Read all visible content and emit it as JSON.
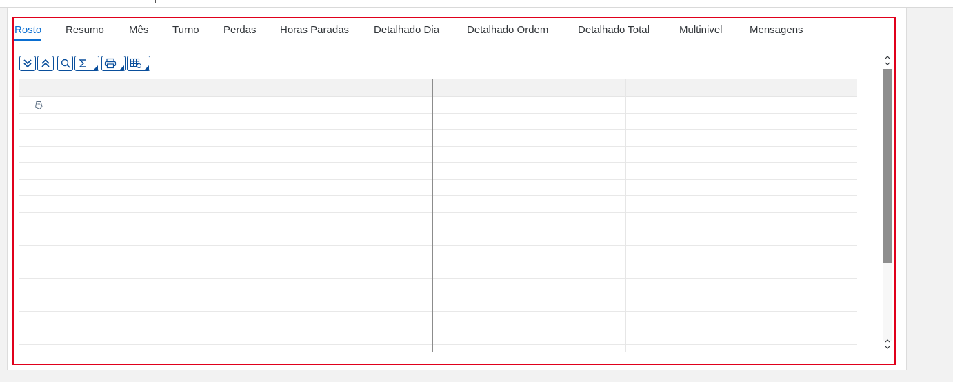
{
  "tabs": [
    {
      "label": "Rosto",
      "active": true
    },
    {
      "label": "Resumo",
      "active": false
    },
    {
      "label": "Mês",
      "active": false
    },
    {
      "label": "Turno",
      "active": false
    },
    {
      "label": "Perdas",
      "active": false
    },
    {
      "label": "Horas Paradas",
      "active": false
    },
    {
      "label": "Detalhado Dia",
      "active": false
    },
    {
      "label": "Detalhado Ordem",
      "active": false
    },
    {
      "label": "Detalhado Total",
      "active": false
    },
    {
      "label": "Multinivel",
      "active": false
    },
    {
      "label": "Mensagens",
      "active": false
    }
  ],
  "toolbar": {
    "buttons": [
      {
        "icon": "expand-all-icon"
      },
      {
        "icon": "collapse-all-icon"
      },
      {
        "icon": "search-icon"
      },
      {
        "icon": "sum-icon",
        "menu": true
      },
      {
        "icon": "print-icon",
        "menu": true
      },
      {
        "icon": "layout-settings-icon",
        "menu": true
      }
    ]
  },
  "grid": {
    "columns": [
      "",
      "",
      "",
      "",
      ""
    ],
    "rows": [
      {
        "icon": "tag-icon"
      },
      {},
      {},
      {},
      {},
      {},
      {},
      {},
      {},
      {},
      {},
      {},
      {},
      {},
      {}
    ]
  },
  "colors": {
    "accent": "#0a6ed1",
    "frame_highlight": "#e0001b",
    "button_border": "#0a4f9c"
  }
}
